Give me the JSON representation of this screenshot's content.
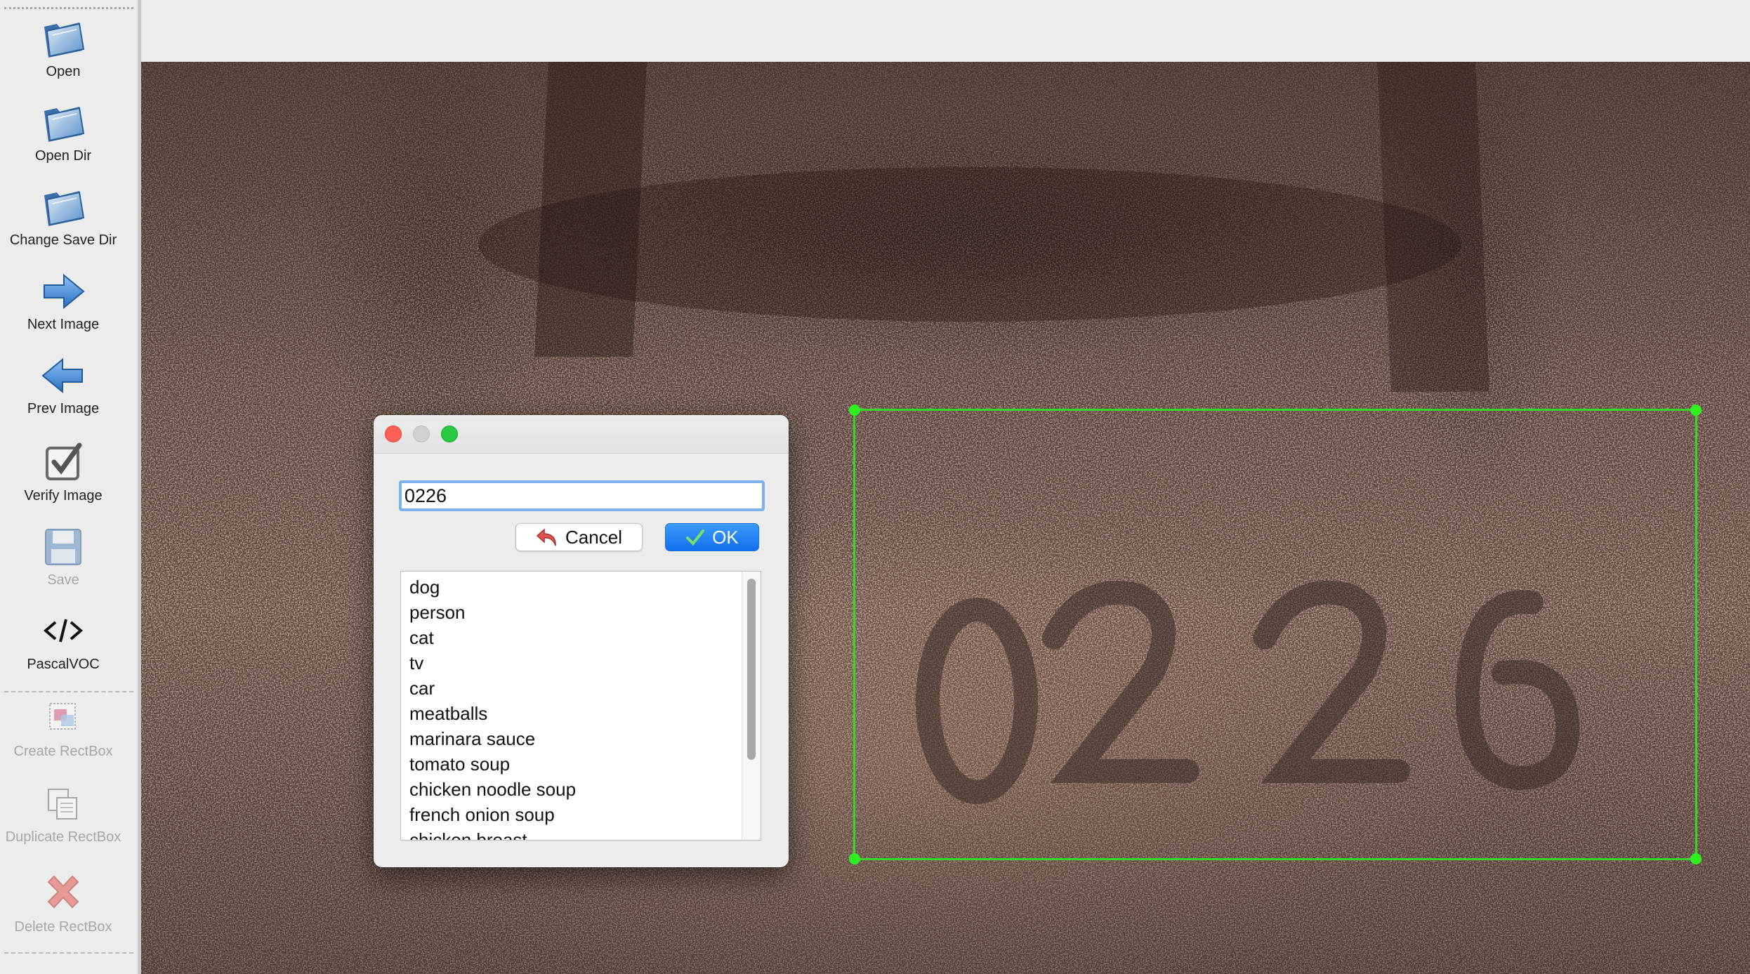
{
  "toolbar": {
    "items": [
      {
        "label": "Open",
        "icon": "folder-icon",
        "enabled": true
      },
      {
        "label": "Open Dir",
        "icon": "folder-icon",
        "enabled": true
      },
      {
        "label": "Change Save Dir",
        "icon": "folder-icon",
        "enabled": true
      },
      {
        "label": "Next Image",
        "icon": "arrow-right-icon",
        "enabled": true
      },
      {
        "label": "Prev Image",
        "icon": "arrow-left-icon",
        "enabled": true
      },
      {
        "label": "Verify Image",
        "icon": "checkbox-icon",
        "enabled": true
      },
      {
        "label": "Save",
        "icon": "floppy-disk-icon",
        "enabled": false
      },
      {
        "label": "PascalVOC",
        "icon": "code-tag-icon",
        "enabled": true
      },
      {
        "label": "Create RectBox",
        "icon": "create-rectbox-icon",
        "enabled": false
      },
      {
        "label": "Duplicate RectBox",
        "icon": "duplicate-icon",
        "enabled": false
      },
      {
        "label": "Delete RectBox",
        "icon": "delete-x-icon",
        "enabled": false
      }
    ]
  },
  "canvas": {
    "image_text": "0226",
    "box_color": "#39d62a"
  },
  "dialog": {
    "input_value": "0226",
    "cancel_label": "Cancel",
    "ok_label": "OK",
    "labels": [
      "dog",
      "person",
      "cat",
      "tv",
      "car",
      "meatballs",
      "marinara sauce",
      "tomato soup",
      "chicken noodle soup",
      "french onion soup",
      "chicken breast"
    ]
  },
  "colors": {
    "accent": "#1170ee",
    "close": "#fe5f57",
    "minimize_disabled": "#d0d0d0",
    "zoom": "#28c840"
  }
}
